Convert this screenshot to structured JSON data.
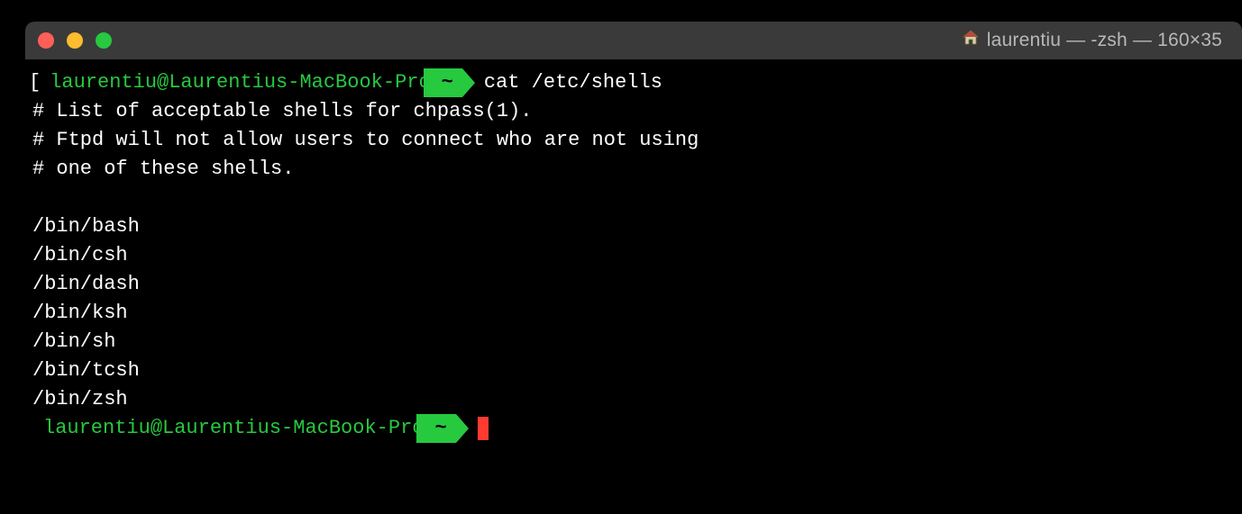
{
  "window": {
    "title": "laurentiu — -zsh — 160×35"
  },
  "prompt": {
    "user_host": "laurentiu@Laurentius-MacBook-Pro",
    "cwd": "~"
  },
  "command": "cat /etc/shells",
  "output_lines": [
    "# List of acceptable shells for chpass(1).",
    "# Ftpd will not allow users to connect who are not using",
    "# one of these shells.",
    "",
    "/bin/bash",
    "/bin/csh",
    "/bin/dash",
    "/bin/ksh",
    "/bin/sh",
    "/bin/tcsh",
    "/bin/zsh"
  ]
}
